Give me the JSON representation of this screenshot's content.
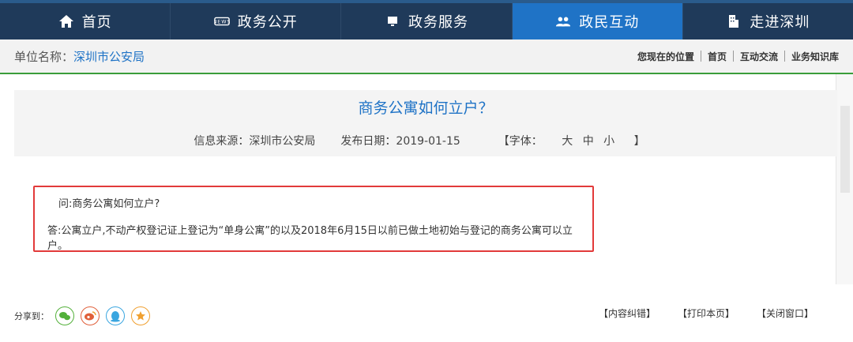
{
  "nav": {
    "items": [
      {
        "label": "首页",
        "icon": "home-icon"
      },
      {
        "label": "政务公开",
        "icon": "news-icon"
      },
      {
        "label": "政务服务",
        "icon": "monitor-icon"
      },
      {
        "label": "政民互动",
        "icon": "users-icon"
      },
      {
        "label": "走进深圳",
        "icon": "building-icon"
      }
    ],
    "active_index": 3
  },
  "unit": {
    "label": "单位名称：",
    "value": "深圳市公安局"
  },
  "breadcrumb": {
    "prefix": "您现在的位置",
    "items": [
      "首页",
      "互动交流",
      "业务知识库"
    ]
  },
  "article": {
    "title": "商务公寓如何立户？",
    "source": "信息来源：深圳市公安局",
    "date": "发布日期：2019-01-15",
    "font_label": "【字体：",
    "font_large": "大",
    "font_medium": "中",
    "font_small": "小",
    "font_end": "】"
  },
  "content": {
    "question": "问:商务公寓如何立户?",
    "answer": "答:公寓立户,不动产权登记证上登记为“单身公寓”的以及2018年6月15日以前已做土地初始与登记的商务公寓可以立户。"
  },
  "footer": {
    "share_label": "分享到：",
    "share_icons": [
      "wechat-icon",
      "weibo-icon",
      "qq-icon",
      "favorite-icon"
    ],
    "actions": [
      "【内容纠错】",
      "【打印本页】",
      "【关闭窗口】"
    ]
  },
  "colors": {
    "nav_bg": "#1f3a5a",
    "nav_active": "#1f73c6",
    "title_blue": "#1f73c6",
    "highlight_red": "#e23a3a",
    "divider_green": "#3a9d3a"
  }
}
